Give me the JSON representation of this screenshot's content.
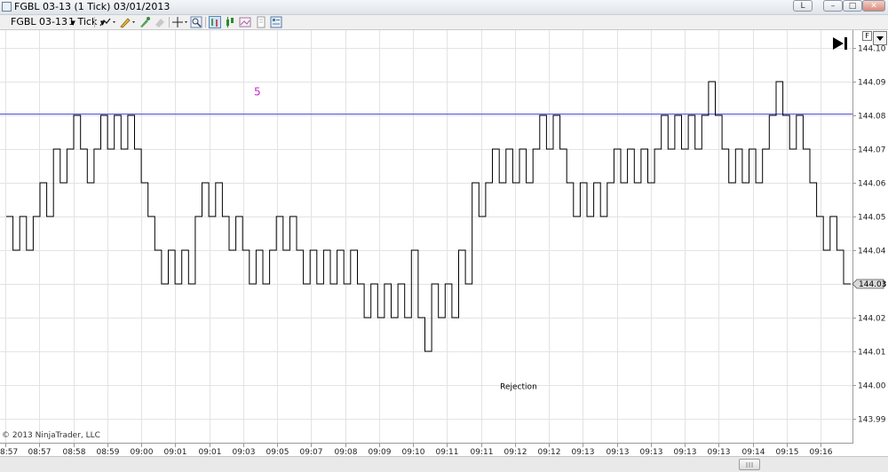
{
  "window": {
    "title": "FGBL 03-13 (1 Tick)  03/01/2013",
    "buttons": {
      "layout": "L",
      "minimize": "–",
      "maximize": "□",
      "close": "✕"
    }
  },
  "toolbar": {
    "instrument": "FGBL 03-13",
    "interval": "1 Tick",
    "icons": [
      "draw-line-icon",
      "pencil-icon",
      "marker-icon",
      "eraser-icon",
      "crosshair-icon",
      "zoom-icon",
      "bars-icon",
      "candle-icon",
      "image-icon",
      "data-box-icon",
      "properties-icon"
    ]
  },
  "chart_data": {
    "type": "line",
    "subtype": "step",
    "x_tick_labels": [
      "8:57",
      "08:57",
      "08:58",
      "08:59",
      "09:00",
      "09:01",
      "09:01",
      "09:03",
      "09:05",
      "09:07",
      "09:08",
      "09:09",
      "09:10",
      "09:11",
      "09:11",
      "09:12",
      "09:12",
      "09:13",
      "09:13",
      "09:13",
      "09:13",
      "09:13",
      "09:14",
      "09:15",
      "09:16"
    ],
    "y_tick_labels": [
      "144.10",
      "144.09",
      "144.08",
      "144.07",
      "144.06",
      "144.05",
      "144.04",
      "144.03",
      "144.02",
      "144.01",
      "144.00",
      "143.99"
    ],
    "ylim": [
      143.985,
      144.112
    ],
    "grid": true,
    "horizontal_line": {
      "value": 144.0805,
      "label": "5",
      "color": "#4040e0",
      "label_color": "#cc22cc"
    },
    "annotation": {
      "text": "Rejection",
      "x_index": 75.5,
      "y": 144.0015
    },
    "last_price": "144.03",
    "copyright": "© 2013 NinjaTrader, LLC",
    "series": [
      {
        "points": [
          [
            0,
            144.05
          ],
          [
            1,
            144.04
          ],
          [
            2,
            144.05
          ],
          [
            3,
            144.04
          ],
          [
            4,
            144.05
          ],
          [
            5,
            144.06
          ],
          [
            6,
            144.05
          ],
          [
            7,
            144.07
          ],
          [
            8,
            144.06
          ],
          [
            9,
            144.07
          ],
          [
            10,
            144.08
          ],
          [
            11,
            144.07
          ],
          [
            12,
            144.06
          ],
          [
            13,
            144.07
          ],
          [
            14,
            144.08
          ],
          [
            15,
            144.07
          ],
          [
            16,
            144.08
          ],
          [
            17,
            144.07
          ],
          [
            18,
            144.08
          ],
          [
            19,
            144.07
          ],
          [
            20,
            144.06
          ],
          [
            21,
            144.05
          ],
          [
            22,
            144.04
          ],
          [
            23,
            144.03
          ],
          [
            24,
            144.04
          ],
          [
            25,
            144.03
          ],
          [
            26,
            144.04
          ],
          [
            27,
            144.03
          ],
          [
            28,
            144.05
          ],
          [
            29,
            144.06
          ],
          [
            30,
            144.05
          ],
          [
            31,
            144.06
          ],
          [
            32,
            144.05
          ],
          [
            33,
            144.04
          ],
          [
            34,
            144.05
          ],
          [
            35,
            144.04
          ],
          [
            36,
            144.03
          ],
          [
            37,
            144.04
          ],
          [
            38,
            144.03
          ],
          [
            39,
            144.04
          ],
          [
            40,
            144.05
          ],
          [
            41,
            144.04
          ],
          [
            42,
            144.05
          ],
          [
            43,
            144.04
          ],
          [
            44,
            144.03
          ],
          [
            45,
            144.04
          ],
          [
            46,
            144.03
          ],
          [
            47,
            144.04
          ],
          [
            48,
            144.03
          ],
          [
            49,
            144.04
          ],
          [
            50,
            144.03
          ],
          [
            51,
            144.04
          ],
          [
            52,
            144.03
          ],
          [
            53,
            144.02
          ],
          [
            54,
            144.03
          ],
          [
            55,
            144.02
          ],
          [
            56,
            144.03
          ],
          [
            57,
            144.02
          ],
          [
            58,
            144.03
          ],
          [
            59,
            144.02
          ],
          [
            60,
            144.04
          ],
          [
            61,
            144.02
          ],
          [
            62,
            144.01
          ],
          [
            63,
            144.03
          ],
          [
            64,
            144.02
          ],
          [
            65,
            144.03
          ],
          [
            66,
            144.02
          ],
          [
            67,
            144.04
          ],
          [
            68,
            144.03
          ],
          [
            69,
            144.06
          ],
          [
            70,
            144.05
          ],
          [
            71,
            144.06
          ],
          [
            72,
            144.07
          ],
          [
            73,
            144.06
          ],
          [
            74,
            144.07
          ],
          [
            75,
            144.06
          ],
          [
            76,
            144.07
          ],
          [
            77,
            144.06
          ],
          [
            78,
            144.07
          ],
          [
            79,
            144.08
          ],
          [
            80,
            144.07
          ],
          [
            81,
            144.08
          ],
          [
            82,
            144.07
          ],
          [
            83,
            144.06
          ],
          [
            84,
            144.05
          ],
          [
            85,
            144.06
          ],
          [
            86,
            144.05
          ],
          [
            87,
            144.06
          ],
          [
            88,
            144.05
          ],
          [
            89,
            144.06
          ],
          [
            90,
            144.07
          ],
          [
            91,
            144.06
          ],
          [
            92,
            144.07
          ],
          [
            93,
            144.06
          ],
          [
            94,
            144.07
          ],
          [
            95,
            144.06
          ],
          [
            96,
            144.07
          ],
          [
            97,
            144.08
          ],
          [
            98,
            144.07
          ],
          [
            99,
            144.08
          ],
          [
            100,
            144.07
          ],
          [
            101,
            144.08
          ],
          [
            102,
            144.07
          ],
          [
            103,
            144.08
          ],
          [
            104,
            144.09
          ],
          [
            105,
            144.08
          ],
          [
            106,
            144.07
          ],
          [
            107,
            144.06
          ],
          [
            108,
            144.07
          ],
          [
            109,
            144.06
          ],
          [
            110,
            144.07
          ],
          [
            111,
            144.06
          ],
          [
            112,
            144.07
          ],
          [
            113,
            144.08
          ],
          [
            114,
            144.09
          ],
          [
            115,
            144.08
          ],
          [
            116,
            144.07
          ],
          [
            117,
            144.08
          ],
          [
            118,
            144.07
          ],
          [
            119,
            144.06
          ],
          [
            120,
            144.05
          ],
          [
            121,
            144.04
          ],
          [
            122,
            144.05
          ],
          [
            123,
            144.04
          ],
          [
            124,
            144.03
          ]
        ]
      }
    ]
  }
}
